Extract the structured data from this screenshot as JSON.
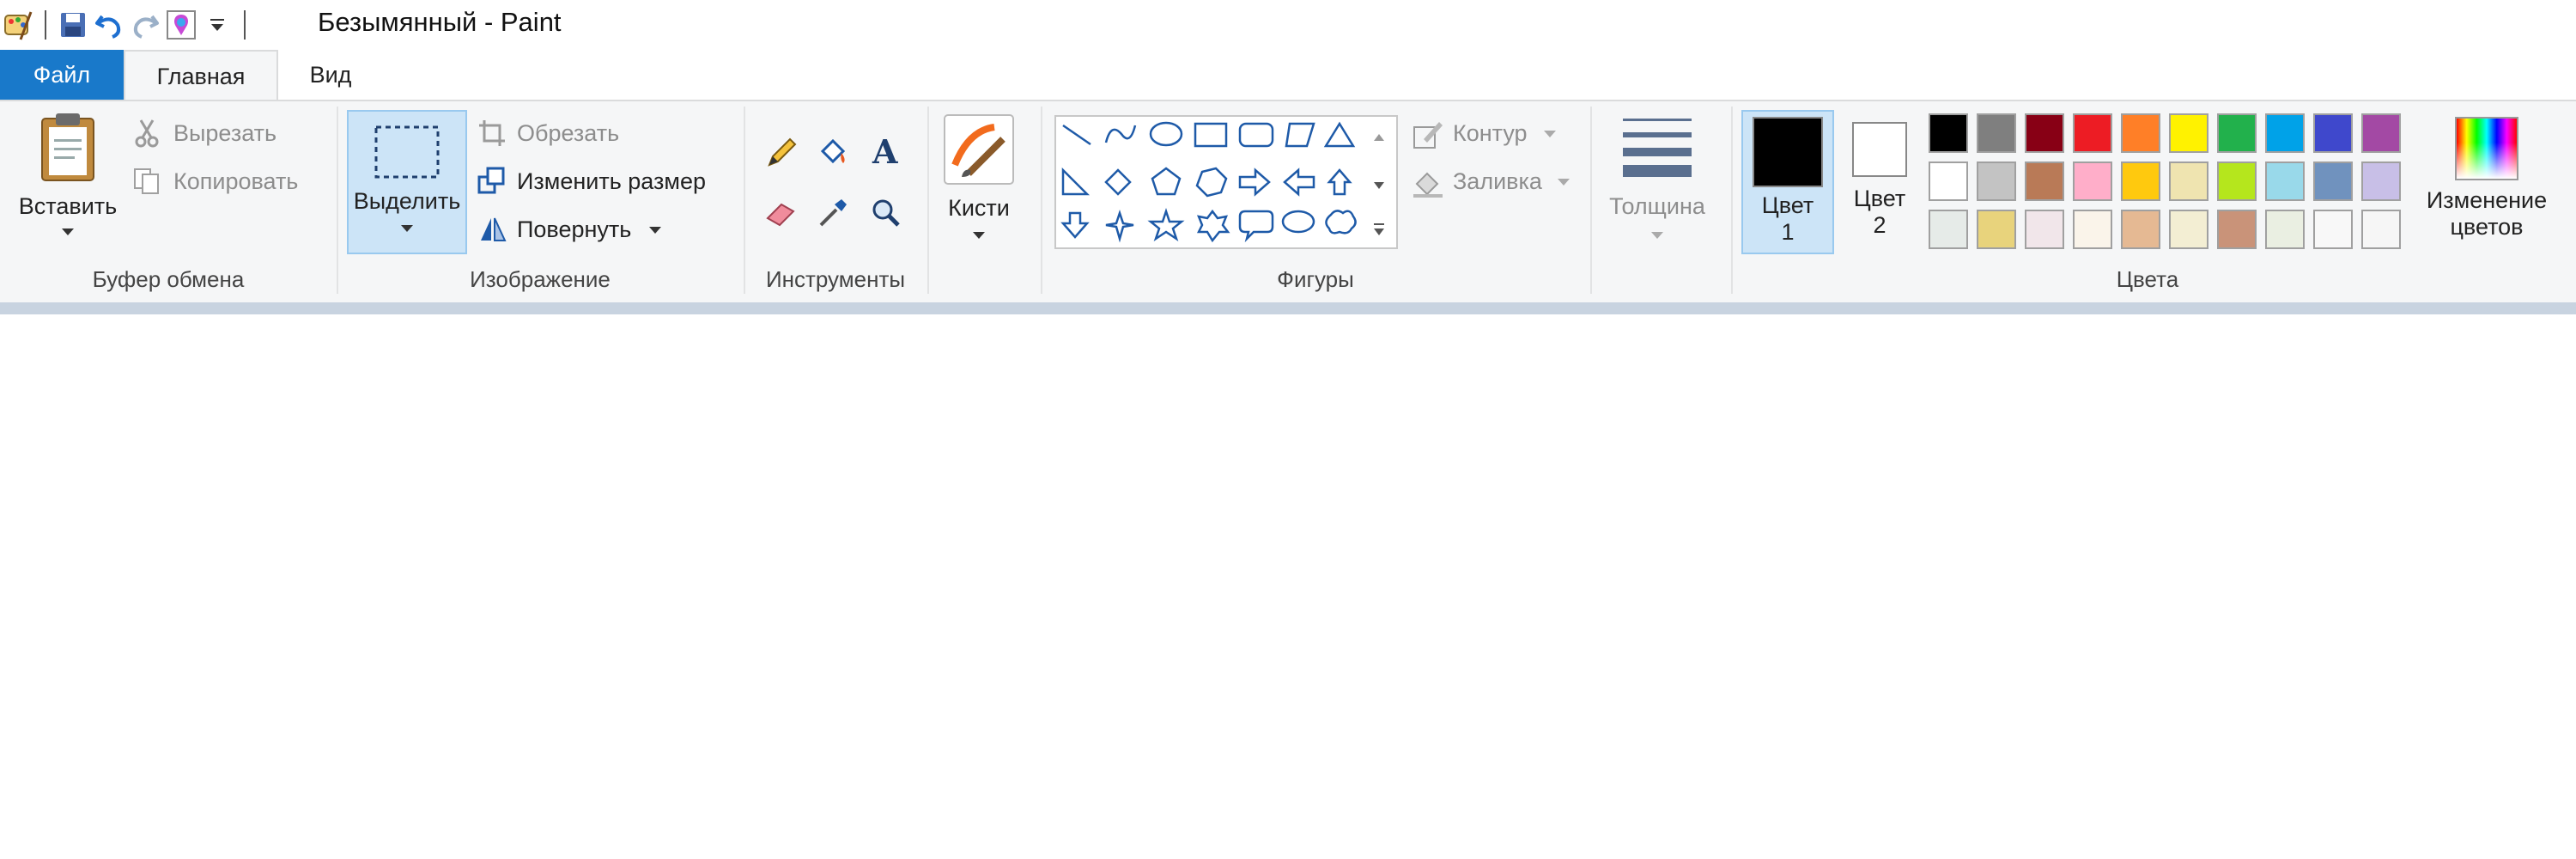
{
  "window": {
    "title": "Безымянный - Paint"
  },
  "tabs": {
    "file": "Файл",
    "home": "Главная",
    "view": "Вид"
  },
  "clipboard": {
    "paste": "Вставить",
    "cut": "Вырезать",
    "copy": "Копировать",
    "group": "Буфер обмена"
  },
  "image": {
    "select": "Выделить",
    "crop": "Обрезать",
    "resize": "Изменить размер",
    "rotate": "Повернуть",
    "group": "Изображение"
  },
  "tools": {
    "group": "Инструменты"
  },
  "brushes": {
    "label": "Кисти"
  },
  "shapes": {
    "outline": "Контур",
    "fill": "Заливка",
    "group": "Фигуры"
  },
  "size": {
    "label": "Толщина"
  },
  "colors": {
    "color1_line1": "Цвет",
    "color1_line2": "1",
    "color2_line1": "Цвет",
    "color2_line2": "2",
    "edit_line1": "Изменение",
    "edit_line2": "цветов",
    "group": "Цвета",
    "palette_row1": [
      "#000000",
      "#7f7f7f",
      "#880015",
      "#ed1c24",
      "#ff7f27",
      "#fff200",
      "#22b14c",
      "#00a2e8",
      "#3f48cc",
      "#a349a4"
    ],
    "palette_row2": [
      "#ffffff",
      "#c3c3c3",
      "#b97a57",
      "#ffaec9",
      "#ffc90e",
      "#efe4b0",
      "#b5e61d",
      "#99d9ea",
      "#7092be",
      "#c8bfe7"
    ],
    "palette_row3": [
      "#e6ebe8",
      "#e8d37c",
      "#f1e6ea",
      "#faf4ea",
      "#e5b993",
      "#f3eed3",
      "#c99379",
      "#eaefe2",
      "#f8f8f8",
      "#f6f6f6"
    ]
  }
}
